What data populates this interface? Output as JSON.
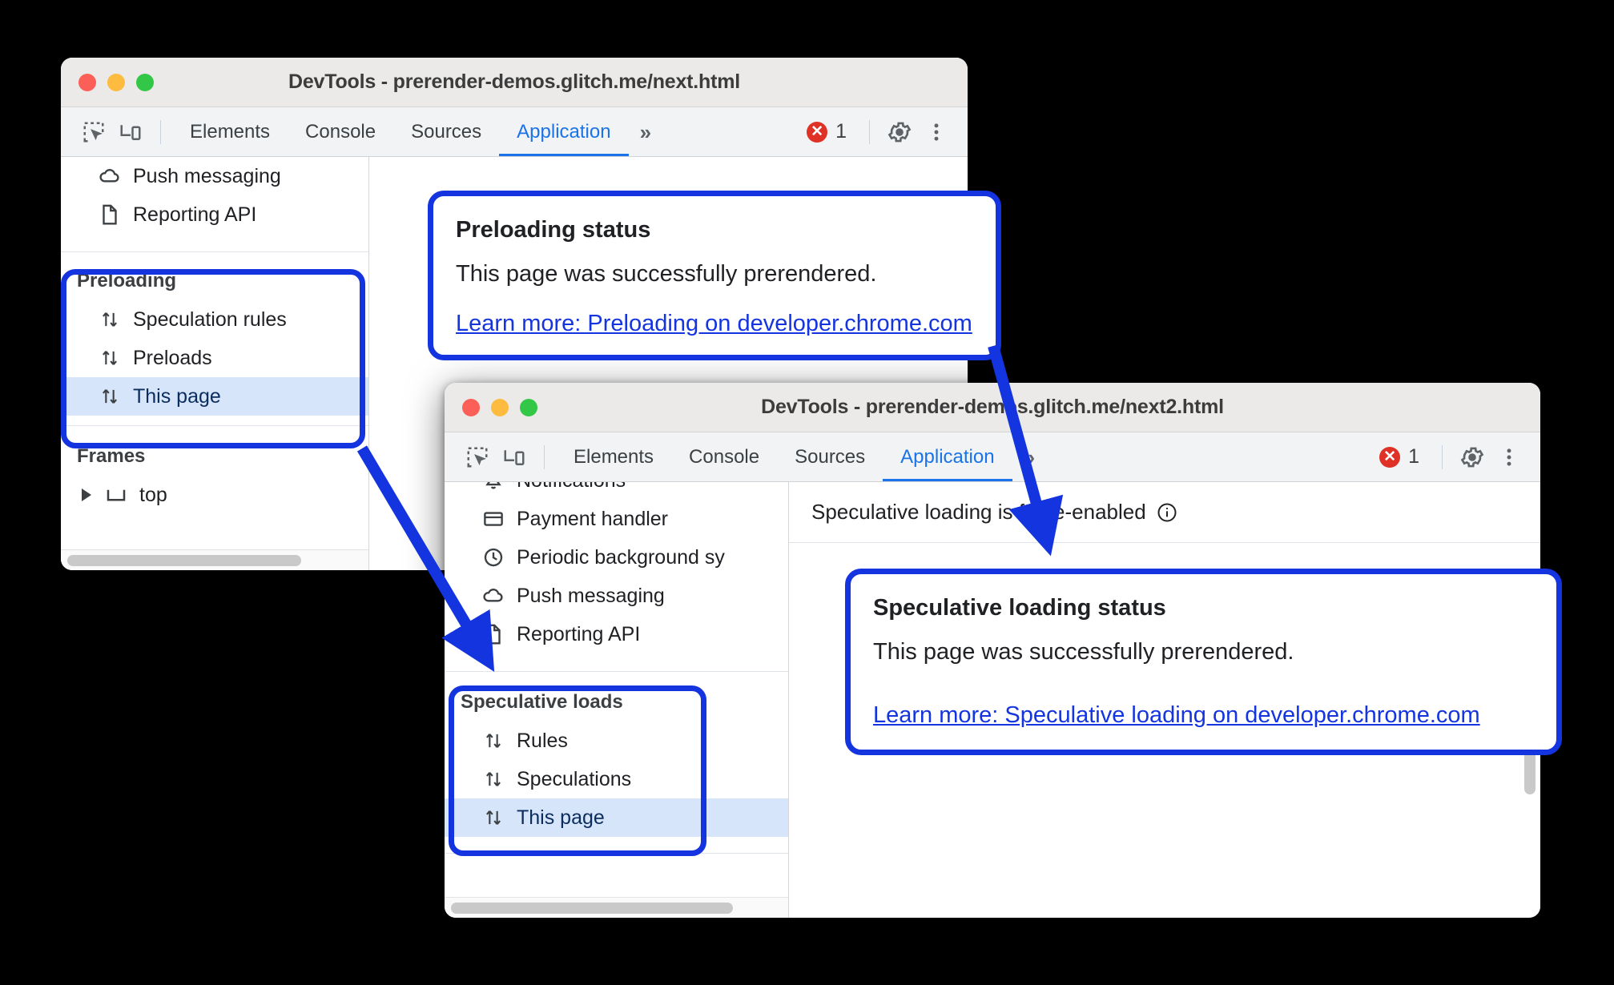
{
  "theme": {
    "annotation_color": "#1434e0",
    "accent_blue": "#1a73e8",
    "error_red": "#e03127",
    "selection_blue": "#d7e5fb"
  },
  "window1": {
    "title": "DevTools - prerender-demos.glitch.me/next.html",
    "toolbar": {
      "inspect_icon": "inspect-element-icon",
      "device_icon": "device-toolbar-icon",
      "tabs": [
        {
          "label": "Elements",
          "active": false
        },
        {
          "label": "Console",
          "active": false
        },
        {
          "label": "Sources",
          "active": false
        },
        {
          "label": "Application",
          "active": true
        }
      ],
      "more_tabs_label": "»",
      "error_count": "1",
      "error_glyph": "✕",
      "settings_icon": "gear-icon",
      "more_icon": "kebab-menu-icon"
    },
    "sidebar": {
      "top_items": [
        {
          "label": "Push messaging",
          "icon": "cloud-icon"
        },
        {
          "label": "Reporting API",
          "icon": "document-icon"
        }
      ],
      "preloading_section": {
        "header": "Preloading",
        "items": [
          {
            "label": "Speculation rules",
            "icon": "updown-arrows-icon",
            "selected": false
          },
          {
            "label": "Preloads",
            "icon": "updown-arrows-icon",
            "selected": false
          },
          {
            "label": "This page",
            "icon": "updown-arrows-icon",
            "selected": true
          }
        ]
      },
      "frames_section": {
        "header": "Frames",
        "items": [
          {
            "label": "top",
            "icon": "frame-icon",
            "expandable": true
          }
        ]
      }
    },
    "callout": {
      "title": "Preloading status",
      "body": "This page was successfully prerendered.",
      "link": "Learn more: Preloading on developer.chrome.com"
    }
  },
  "window2": {
    "title": "DevTools - prerender-demos.glitch.me/next2.html",
    "toolbar": {
      "inspect_icon": "inspect-element-icon",
      "device_icon": "device-toolbar-icon",
      "tabs": [
        {
          "label": "Elements",
          "active": false
        },
        {
          "label": "Console",
          "active": false
        },
        {
          "label": "Sources",
          "active": false
        },
        {
          "label": "Application",
          "active": true
        }
      ],
      "more_tabs_label": "»",
      "error_count": "1",
      "error_glyph": "✕",
      "settings_icon": "gear-icon",
      "more_icon": "kebab-menu-icon"
    },
    "sidebar": {
      "top_items": [
        {
          "label": "Notifications",
          "icon": "bell-icon"
        },
        {
          "label": "Payment handler",
          "icon": "credit-card-icon"
        },
        {
          "label": "Periodic background sy",
          "icon": "clock-icon"
        },
        {
          "label": "Push messaging",
          "icon": "cloud-icon"
        },
        {
          "label": "Reporting API",
          "icon": "document-icon"
        }
      ],
      "speculative_section": {
        "header": "Speculative loads",
        "items": [
          {
            "label": "Rules",
            "icon": "updown-arrows-icon",
            "selected": false
          },
          {
            "label": "Speculations",
            "icon": "updown-arrows-icon",
            "selected": false
          },
          {
            "label": "This page",
            "icon": "updown-arrows-icon",
            "selected": true
          }
        ]
      }
    },
    "banner": {
      "text": "Speculative loading is force-enabled",
      "info_icon": "info-icon"
    },
    "callout": {
      "title": "Speculative loading status",
      "body": "This page was successfully prerendered.",
      "link": "Learn more: Speculative loading on developer.chrome.com"
    }
  }
}
